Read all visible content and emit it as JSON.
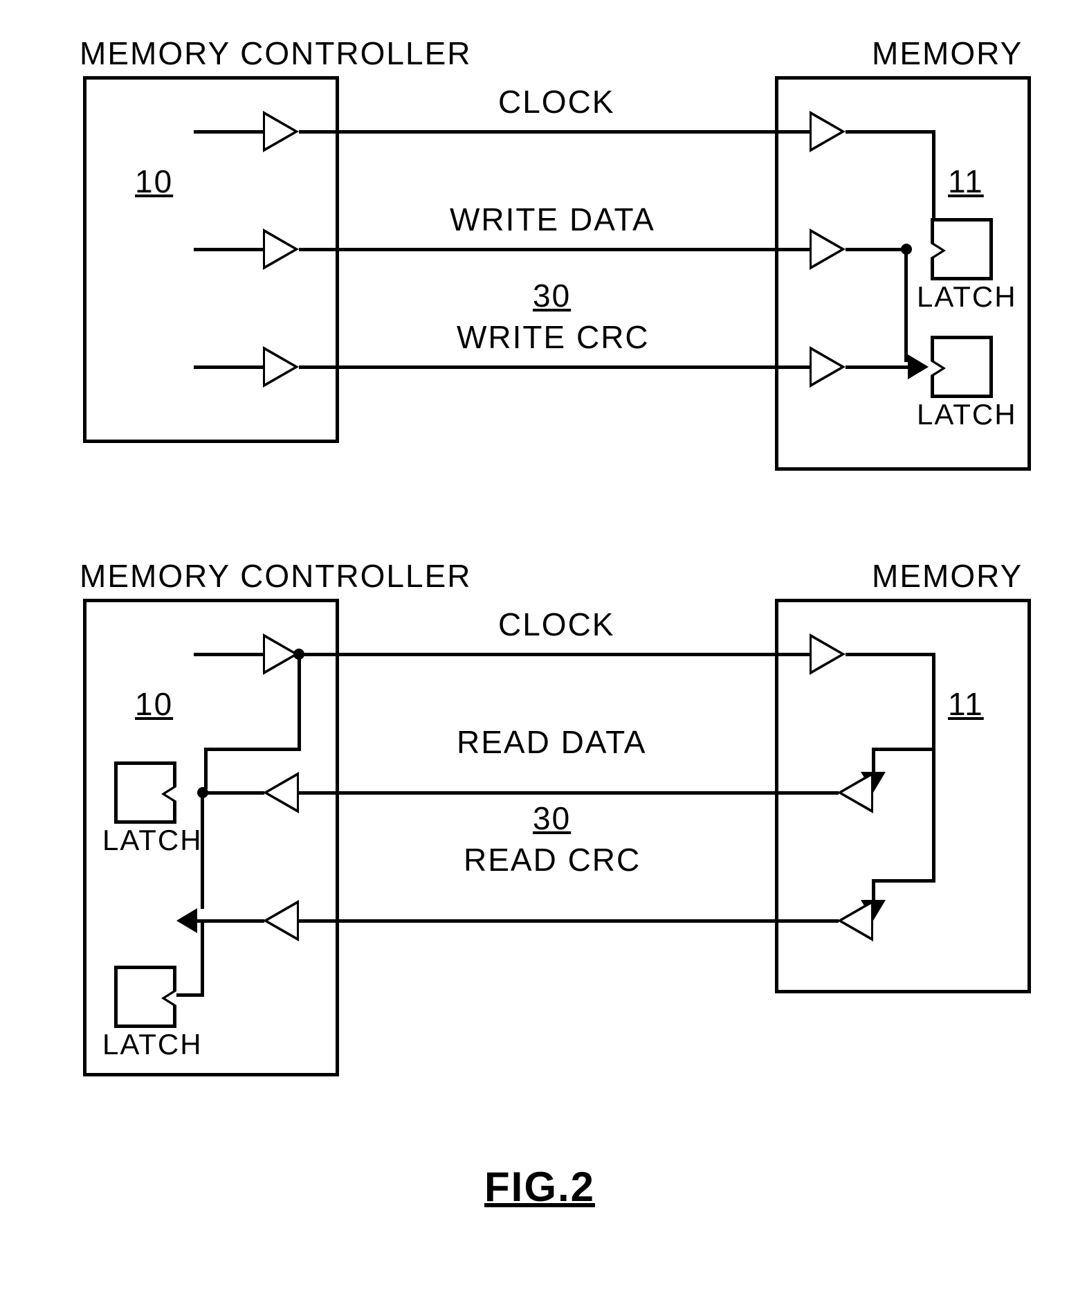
{
  "top": {
    "controller_label": "MEMORY CONTROLLER",
    "memory_label": "MEMORY",
    "controller_ref": "10",
    "memory_ref": "11",
    "channel_ref": "30",
    "signals": {
      "clock": "CLOCK",
      "data": "WRITE DATA",
      "crc": "WRITE CRC"
    },
    "latch1": "LATCH",
    "latch2": "LATCH"
  },
  "bottom": {
    "controller_label": "MEMORY CONTROLLER",
    "memory_label": "MEMORY",
    "controller_ref": "10",
    "memory_ref": "11",
    "channel_ref": "30",
    "signals": {
      "clock": "CLOCK",
      "data": "READ DATA",
      "crc": "READ CRC"
    },
    "latch1": "LATCH",
    "latch2": "LATCH"
  },
  "figure_label": "FIG.2"
}
